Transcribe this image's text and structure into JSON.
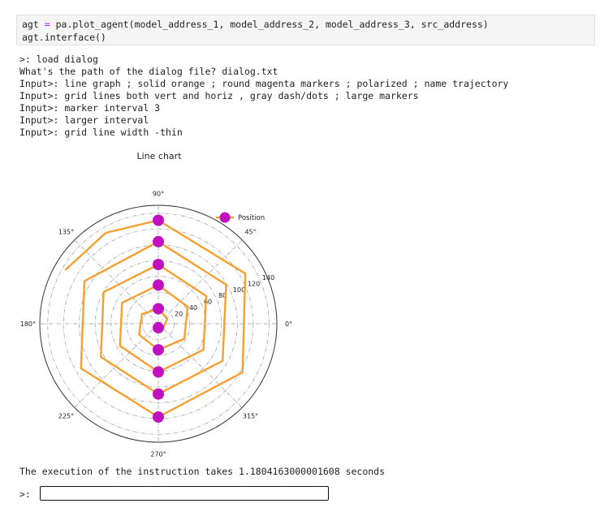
{
  "code_cell": {
    "line1": {
      "a": "agt",
      "eq": "=",
      "b": "pa.plot_agent(model_address_1, model_address_2, model_address_3, src_address)"
    },
    "line2": "agt.interface()"
  },
  "output_lines": [
    ">: load dialog",
    "What's the path of the dialog file? dialog.txt",
    "Input>: line graph ; solid orange ; round magenta markers ; polarized ; name trajectory",
    "Input>: grid lines both vert and horiz , gray dash/dots ; large markers",
    "Input>: marker interval 3",
    "Input>: larger interval",
    "Input>: grid line width -thin"
  ],
  "execution_text": "The execution of the instruction takes 1.1804163000001608 seconds",
  "prompt": {
    "label": ">:",
    "value": "",
    "placeholder": ""
  },
  "chart_data": {
    "type": "line",
    "projection": "polar",
    "title": "Line chart",
    "legend": {
      "entries": [
        "Position"
      ],
      "placement": "top-right"
    },
    "theta_ticks": [
      "0°",
      "45°",
      "90°",
      "135°",
      "180°",
      "225°",
      "270°",
      "315°"
    ],
    "r_ticks": [
      "20",
      "40",
      "60",
      "80",
      "100",
      "120",
      "140"
    ],
    "r_max": 150,
    "grid": true,
    "grid_style": "dashdot",
    "line_color": "#f5a030",
    "marker_color": "#c010c0",
    "series": [
      {
        "name": "Position",
        "theta_deg": [
          -90,
          -30,
          30,
          90,
          150,
          210,
          270,
          330,
          390,
          450,
          510,
          570,
          630,
          690,
          750,
          810,
          870,
          930,
          990,
          1050,
          1110,
          1170,
          1230,
          1290,
          1350,
          1410,
          1470,
          1530,
          1560,
          1590
        ],
        "r": [
          5,
          8,
          13,
          19,
          24,
          28,
          33,
          38,
          43,
          49,
          53,
          56,
          61,
          66,
          70,
          75,
          80,
          84,
          89,
          94,
          99,
          104,
          108,
          113,
          118,
          123,
          127,
          131,
          133,
          136
        ],
        "marker_every": 3
      }
    ]
  }
}
